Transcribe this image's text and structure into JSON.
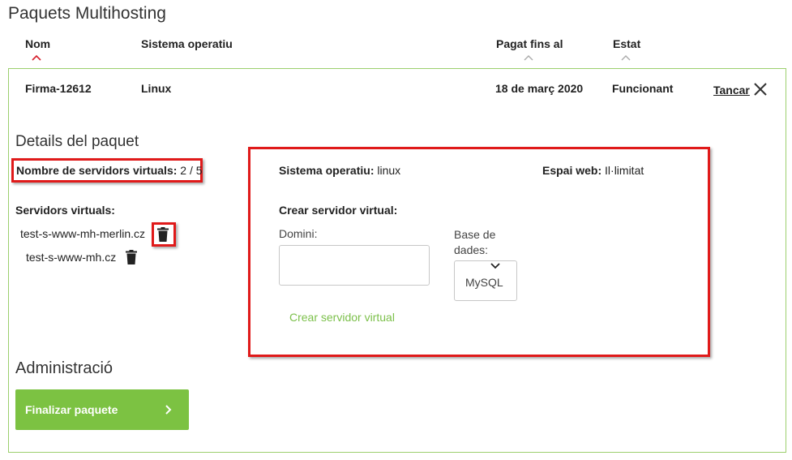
{
  "page": {
    "title": "Paquets Multihosting"
  },
  "table": {
    "headers": {
      "name": "Nom",
      "os": "Sistema operatiu",
      "paid_until": "Pagat fins al",
      "status": "Estat"
    },
    "row": {
      "name": "Firma-12612",
      "os": "Linux",
      "paid_until": "18 de març 2020",
      "status": "Funcionant",
      "close_label": "Tancar"
    }
  },
  "details": {
    "title": "Details del paquet",
    "vs_count_label": "Nombre de servidors virtuals:",
    "vs_count_value": "2 / 5",
    "vs_list_label": "Servidors virtuals:",
    "servers": [
      "test-s-www-mh-merlin.cz",
      "test-s-www-mh.cz"
    ]
  },
  "info": {
    "os_label": "Sistema operatiu:",
    "os_value": "linux",
    "web_label": "Espai web:",
    "web_value": "Il·limitat"
  },
  "create": {
    "title": "Crear servidor virtual:",
    "domain_label": "Domini:",
    "domain_value": "",
    "db_label_line1": "Base de",
    "db_label_line2": "dades:",
    "db_selected": "MySQL",
    "submit_label": "Crear servidor virtual"
  },
  "admin": {
    "title": "Administració",
    "finalize_label": "Finalizar paquete"
  },
  "colors": {
    "accent_green": "#7cc242",
    "highlight_red": "#e01a1a",
    "sort_active": "#d61f2b"
  }
}
